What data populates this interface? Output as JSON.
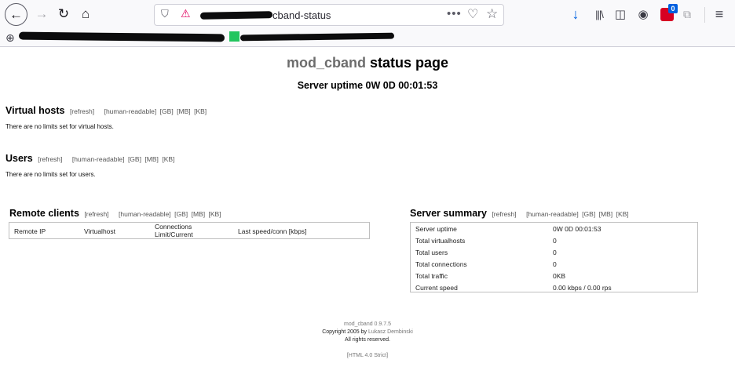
{
  "browser": {
    "url_text": "cband-status",
    "download_badge": "0"
  },
  "page": {
    "title_prefix": "mod_cband",
    "title_suffix": " status page",
    "uptime_heading": "Server uptime 0W 0D 00:01:53"
  },
  "links": {
    "refresh": "[refresh]",
    "human": "[human-readable]",
    "gb": "[GB]",
    "mb": "[MB]",
    "kb": "[KB]"
  },
  "virtual_hosts": {
    "heading": "Virtual hosts",
    "message": "There are no limits set for virtual hosts."
  },
  "users": {
    "heading": "Users",
    "message": "There are no limits set for users."
  },
  "remote_clients": {
    "heading": "Remote clients",
    "columns": [
      "Remote IP",
      "Virtualhost",
      "Connections\nLimit/Current",
      "Last speed/conn [kbps]"
    ],
    "col_conn_line1": "Connections",
    "col_conn_line2": "Limit/Current"
  },
  "server_summary": {
    "heading": "Server summary",
    "rows": [
      {
        "label": "Server uptime",
        "value": "0W 0D 00:01:53"
      },
      {
        "label": "Total virtualhosts",
        "value": "0"
      },
      {
        "label": "Total users",
        "value": "0"
      },
      {
        "label": "Total connections",
        "value": "0"
      },
      {
        "label": "Total traffic",
        "value": "0KB"
      },
      {
        "label": "Current speed",
        "value": "0.00 kbps / 0.00 rps"
      }
    ]
  },
  "footer": {
    "version": "mod_cband 0.9.7.5",
    "copyright_prefix": "Copyright 2005 by ",
    "author": "Lukasz Dembinski",
    "rights": "All rights reserved.",
    "html_badge": "[HTML 4.0 Strict]"
  }
}
